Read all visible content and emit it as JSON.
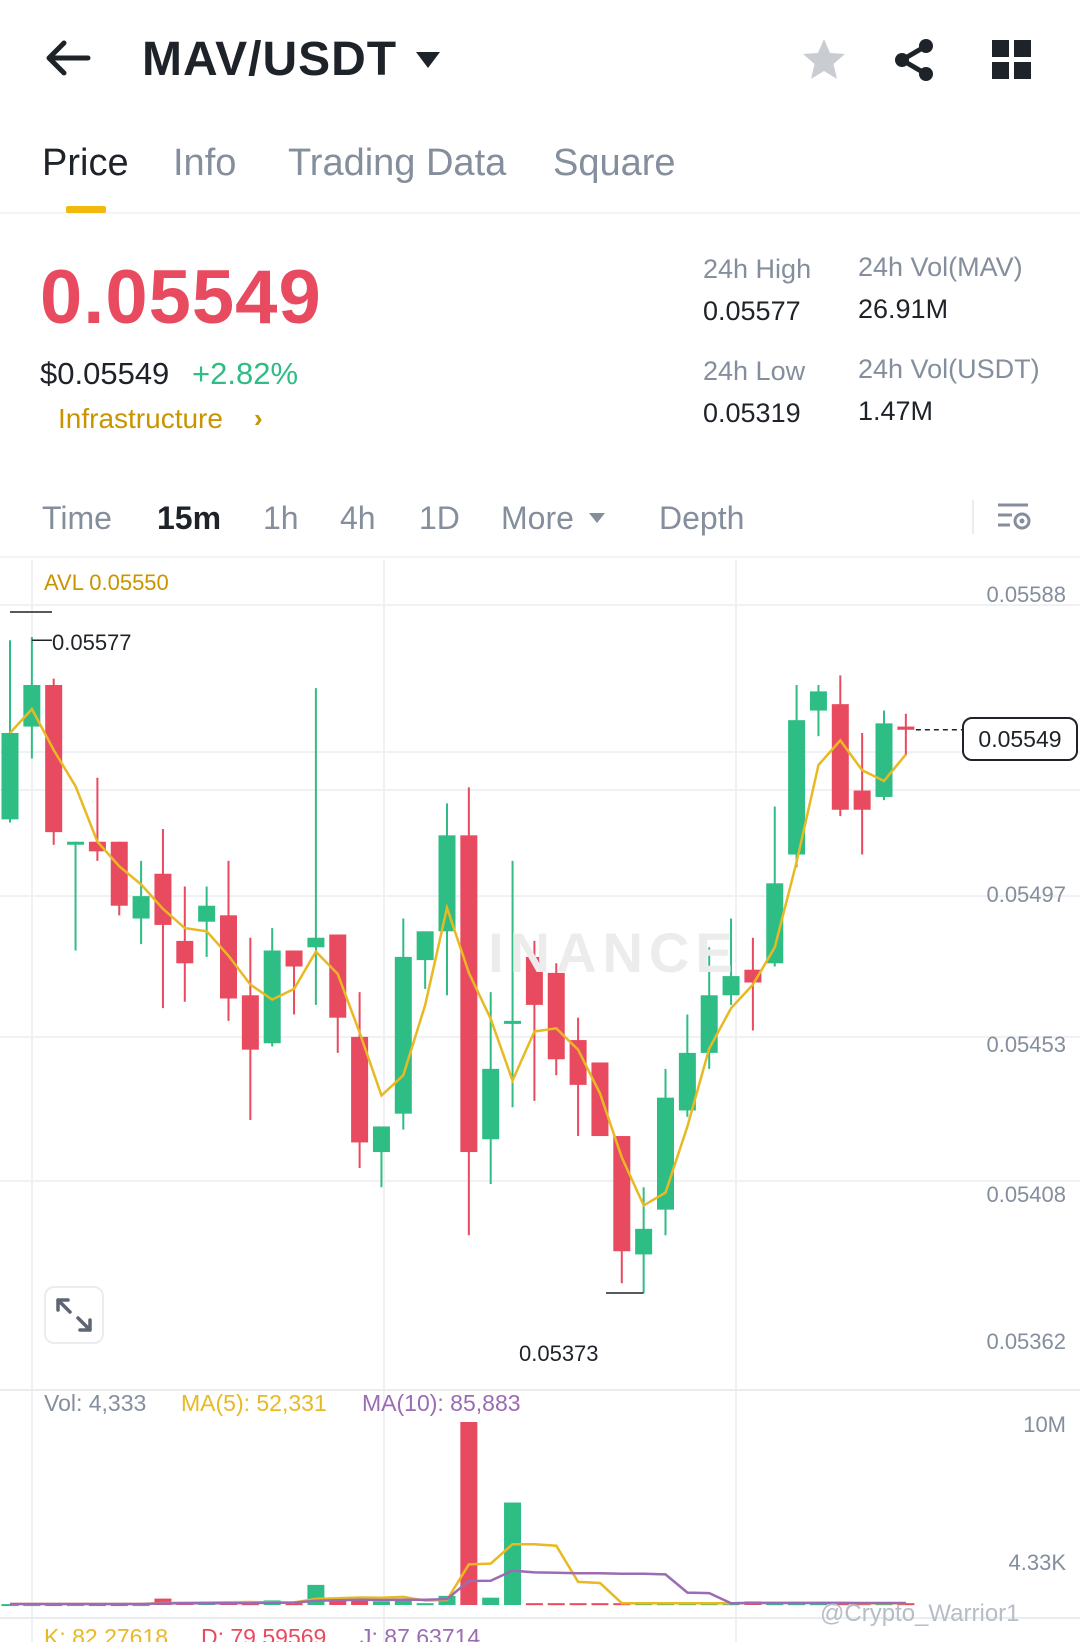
{
  "header": {
    "pair": "MAV/USDT",
    "icons": [
      "back-arrow-icon",
      "chevron-down-icon",
      "star-icon",
      "share-icon",
      "grid-icon"
    ]
  },
  "tabs": [
    {
      "label": "Price",
      "active": true
    },
    {
      "label": "Info",
      "active": false
    },
    {
      "label": "Trading Data",
      "active": false
    },
    {
      "label": "Square",
      "active": false
    }
  ],
  "ticker": {
    "price": "0.05549",
    "price_usd": "$0.05549",
    "change": "+2.82%",
    "sector": "Infrastructure",
    "sector_arrow": "›",
    "high_label": "24h High",
    "high_value": "0.05577",
    "low_label": "24h Low",
    "low_value": "0.05319",
    "vol_base_label": "24h Vol(MAV)",
    "vol_base_value": "26.91M",
    "vol_quote_label": "24h Vol(USDT)",
    "vol_quote_value": "1.47M"
  },
  "intervals": {
    "time": "Time",
    "m15": "15m",
    "h1": "1h",
    "h4": "4h",
    "d1": "1D",
    "more": "More",
    "depth": "Depth",
    "active": "15m"
  },
  "colors": {
    "up": "#2ebd85",
    "down": "#e84a5f",
    "accent": "#f0b90b",
    "ma5": "#e8b923",
    "ma10": "#9b6bb3"
  },
  "chart_data": {
    "type": "candlestick",
    "avl_label": "AVL 0.05550",
    "y_ticks": [
      "0.05588",
      "0.05497",
      "0.05453",
      "0.05408",
      "0.05362"
    ],
    "y_tick_values": [
      0.05588,
      0.05497,
      0.05453,
      0.05408,
      0.05362
    ],
    "ylim": [
      0.05362,
      0.05588
    ],
    "high_marker": "0.05577",
    "low_marker": "0.05373",
    "current_price": "0.05549",
    "candles": [
      {
        "o": 0.05521,
        "h": 0.05577,
        "l": 0.0552,
        "c": 0.05548
      },
      {
        "o": 0.0555,
        "h": 0.05578,
        "l": 0.0554,
        "c": 0.05563
      },
      {
        "o": 0.05563,
        "h": 0.05565,
        "l": 0.05513,
        "c": 0.05517
      },
      {
        "o": 0.05514,
        "h": 0.05514,
        "l": 0.0548,
        "c": 0.05514
      },
      {
        "o": 0.05514,
        "h": 0.05534,
        "l": 0.05508,
        "c": 0.05511
      },
      {
        "o": 0.05514,
        "h": 0.05514,
        "l": 0.05491,
        "c": 0.05494
      },
      {
        "o": 0.0549,
        "h": 0.05508,
        "l": 0.05482,
        "c": 0.05497
      },
      {
        "o": 0.05504,
        "h": 0.05518,
        "l": 0.05462,
        "c": 0.05488
      },
      {
        "o": 0.05483,
        "h": 0.055,
        "l": 0.05464,
        "c": 0.05476
      },
      {
        "o": 0.05489,
        "h": 0.055,
        "l": 0.05478,
        "c": 0.05494
      },
      {
        "o": 0.05491,
        "h": 0.05508,
        "l": 0.05458,
        "c": 0.05465
      },
      {
        "o": 0.05466,
        "h": 0.05484,
        "l": 0.05427,
        "c": 0.05449
      },
      {
        "o": 0.05451,
        "h": 0.05487,
        "l": 0.0545,
        "c": 0.0548
      },
      {
        "o": 0.0548,
        "h": 0.05477,
        "l": 0.0546,
        "c": 0.05475
      },
      {
        "o": 0.05481,
        "h": 0.05562,
        "l": 0.05463,
        "c": 0.05484
      },
      {
        "o": 0.05485,
        "h": 0.05485,
        "l": 0.05448,
        "c": 0.05459
      },
      {
        "o": 0.05453,
        "h": 0.05467,
        "l": 0.05412,
        "c": 0.0542
      },
      {
        "o": 0.05417,
        "h": 0.05424,
        "l": 0.05406,
        "c": 0.05425
      },
      {
        "o": 0.05429,
        "h": 0.0549,
        "l": 0.05424,
        "c": 0.05478
      },
      {
        "o": 0.05477,
        "h": 0.05485,
        "l": 0.05468,
        "c": 0.05486
      },
      {
        "o": 0.05486,
        "h": 0.05526,
        "l": 0.05466,
        "c": 0.05516
      },
      {
        "o": 0.05516,
        "h": 0.05531,
        "l": 0.05391,
        "c": 0.05417
      },
      {
        "o": 0.05421,
        "h": 0.05467,
        "l": 0.05407,
        "c": 0.05443
      },
      {
        "o": 0.05458,
        "h": 0.05508,
        "l": 0.05431,
        "c": 0.05458
      },
      {
        "o": 0.05478,
        "h": 0.05483,
        "l": 0.05433,
        "c": 0.05463
      },
      {
        "o": 0.05473,
        "h": 0.05476,
        "l": 0.05441,
        "c": 0.05446
      },
      {
        "o": 0.05452,
        "h": 0.05459,
        "l": 0.05422,
        "c": 0.05438
      },
      {
        "o": 0.05445,
        "h": 0.05445,
        "l": 0.05432,
        "c": 0.05422
      },
      {
        "o": 0.05422,
        "h": 0.05422,
        "l": 0.05376,
        "c": 0.05386
      },
      {
        "o": 0.05385,
        "h": 0.05406,
        "l": 0.05373,
        "c": 0.05393
      },
      {
        "o": 0.05399,
        "h": 0.05443,
        "l": 0.05391,
        "c": 0.05434
      },
      {
        "o": 0.0543,
        "h": 0.0546,
        "l": 0.05428,
        "c": 0.05448
      },
      {
        "o": 0.05448,
        "h": 0.05481,
        "l": 0.05443,
        "c": 0.05466
      },
      {
        "o": 0.05466,
        "h": 0.0549,
        "l": 0.05463,
        "c": 0.05472
      },
      {
        "o": 0.05474,
        "h": 0.05484,
        "l": 0.05455,
        "c": 0.0547
      },
      {
        "o": 0.05476,
        "h": 0.05525,
        "l": 0.05475,
        "c": 0.05501
      },
      {
        "o": 0.0551,
        "h": 0.05563,
        "l": 0.05506,
        "c": 0.05552
      },
      {
        "o": 0.05555,
        "h": 0.05563,
        "l": 0.05547,
        "c": 0.05561
      },
      {
        "o": 0.05557,
        "h": 0.05566,
        "l": 0.05522,
        "c": 0.05524
      },
      {
        "o": 0.0553,
        "h": 0.05548,
        "l": 0.0551,
        "c": 0.05524
      },
      {
        "o": 0.05528,
        "h": 0.05555,
        "l": 0.05527,
        "c": 0.05551
      },
      {
        "o": 0.0555,
        "h": 0.05554,
        "l": 0.05541,
        "c": 0.05549
      }
    ],
    "volume_panel": {
      "vol_label": "Vol: 4,333",
      "ma5_label": "MA(5): 52,331",
      "ma10_label": "MA(10): 85,883",
      "y_ticks": [
        "10M",
        "4.33K"
      ],
      "volumes_m": [
        0.05,
        0.05,
        0.05,
        0.05,
        0.05,
        0.05,
        0.05,
        0.35,
        0.12,
        0.12,
        0.12,
        0.1,
        0.25,
        0.1,
        1.1,
        0.3,
        0.3,
        0.2,
        0.3,
        0.1,
        0.5,
        10.0,
        0.4,
        5.6,
        0.1,
        0.1,
        0.1,
        0.1,
        0.1,
        0.1,
        0.1,
        0.1,
        0.1,
        0.1,
        0.2,
        0.1,
        0.1,
        0.1,
        0.1,
        0.1,
        0.1,
        0.1
      ]
    },
    "kdj_panel": {
      "k_label": "K: 82.27618",
      "d_label": "D: 79.59569",
      "j_label": "J: 87.63714"
    }
  },
  "credit": "@Crypto_Warrior1"
}
